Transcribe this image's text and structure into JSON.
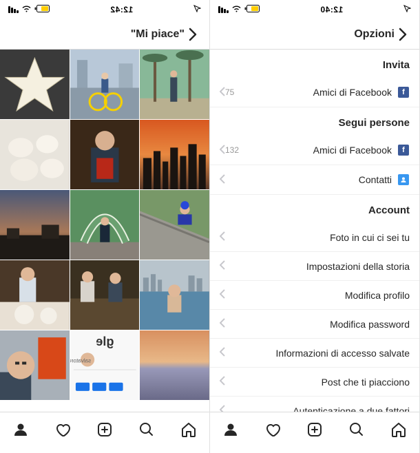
{
  "leftScreen": {
    "status": {
      "time": "12:42"
    },
    "header": {
      "title": "\"Mi piace\""
    },
    "photos": [
      {
        "id": "p1",
        "name": "star-ornament"
      },
      {
        "id": "p2",
        "name": "cyclist-city"
      },
      {
        "id": "p3",
        "name": "man-palm-trees"
      },
      {
        "id": "p4",
        "name": "meringues"
      },
      {
        "id": "p5",
        "name": "man-red-book"
      },
      {
        "id": "p6",
        "name": "sunset-skyline"
      },
      {
        "id": "p7",
        "name": "sunset-rooftops"
      },
      {
        "id": "p8",
        "name": "flower-arch"
      },
      {
        "id": "p9",
        "name": "luge-track"
      },
      {
        "id": "p10",
        "name": "man-dining"
      },
      {
        "id": "p11",
        "name": "two-men-restaurant"
      },
      {
        "id": "p12",
        "name": "infinity-pool"
      },
      {
        "id": "p13",
        "name": "selfie-street"
      },
      {
        "id": "p14",
        "name": "google-profile"
      },
      {
        "id": "p15",
        "name": "beach-sunset"
      }
    ]
  },
  "rightScreen": {
    "status": {
      "time": "12:40"
    },
    "header": {
      "title": "Opzioni"
    },
    "sections": [
      {
        "title": "Invita",
        "rows": [
          {
            "label": "Amici di Facebook",
            "count": "75",
            "icon": "facebook"
          }
        ]
      },
      {
        "title": "Segui persone",
        "rows": [
          {
            "label": "Amici di Facebook",
            "count": "132",
            "icon": "facebook"
          },
          {
            "label": "Contatti",
            "icon": "contacts"
          }
        ]
      },
      {
        "title": "Account",
        "rows": [
          {
            "label": "Foto in cui ci sei tu"
          },
          {
            "label": "Impostazioni della storia"
          },
          {
            "label": "Modifica profilo"
          },
          {
            "label": "Modifica password"
          },
          {
            "label": "Informazioni di accesso salvate"
          },
          {
            "label": "Post che ti piacciono"
          },
          {
            "label": "Autenticazione a due fattori"
          }
        ]
      }
    ]
  },
  "tabs": [
    "profile",
    "activity",
    "post",
    "search",
    "home"
  ]
}
